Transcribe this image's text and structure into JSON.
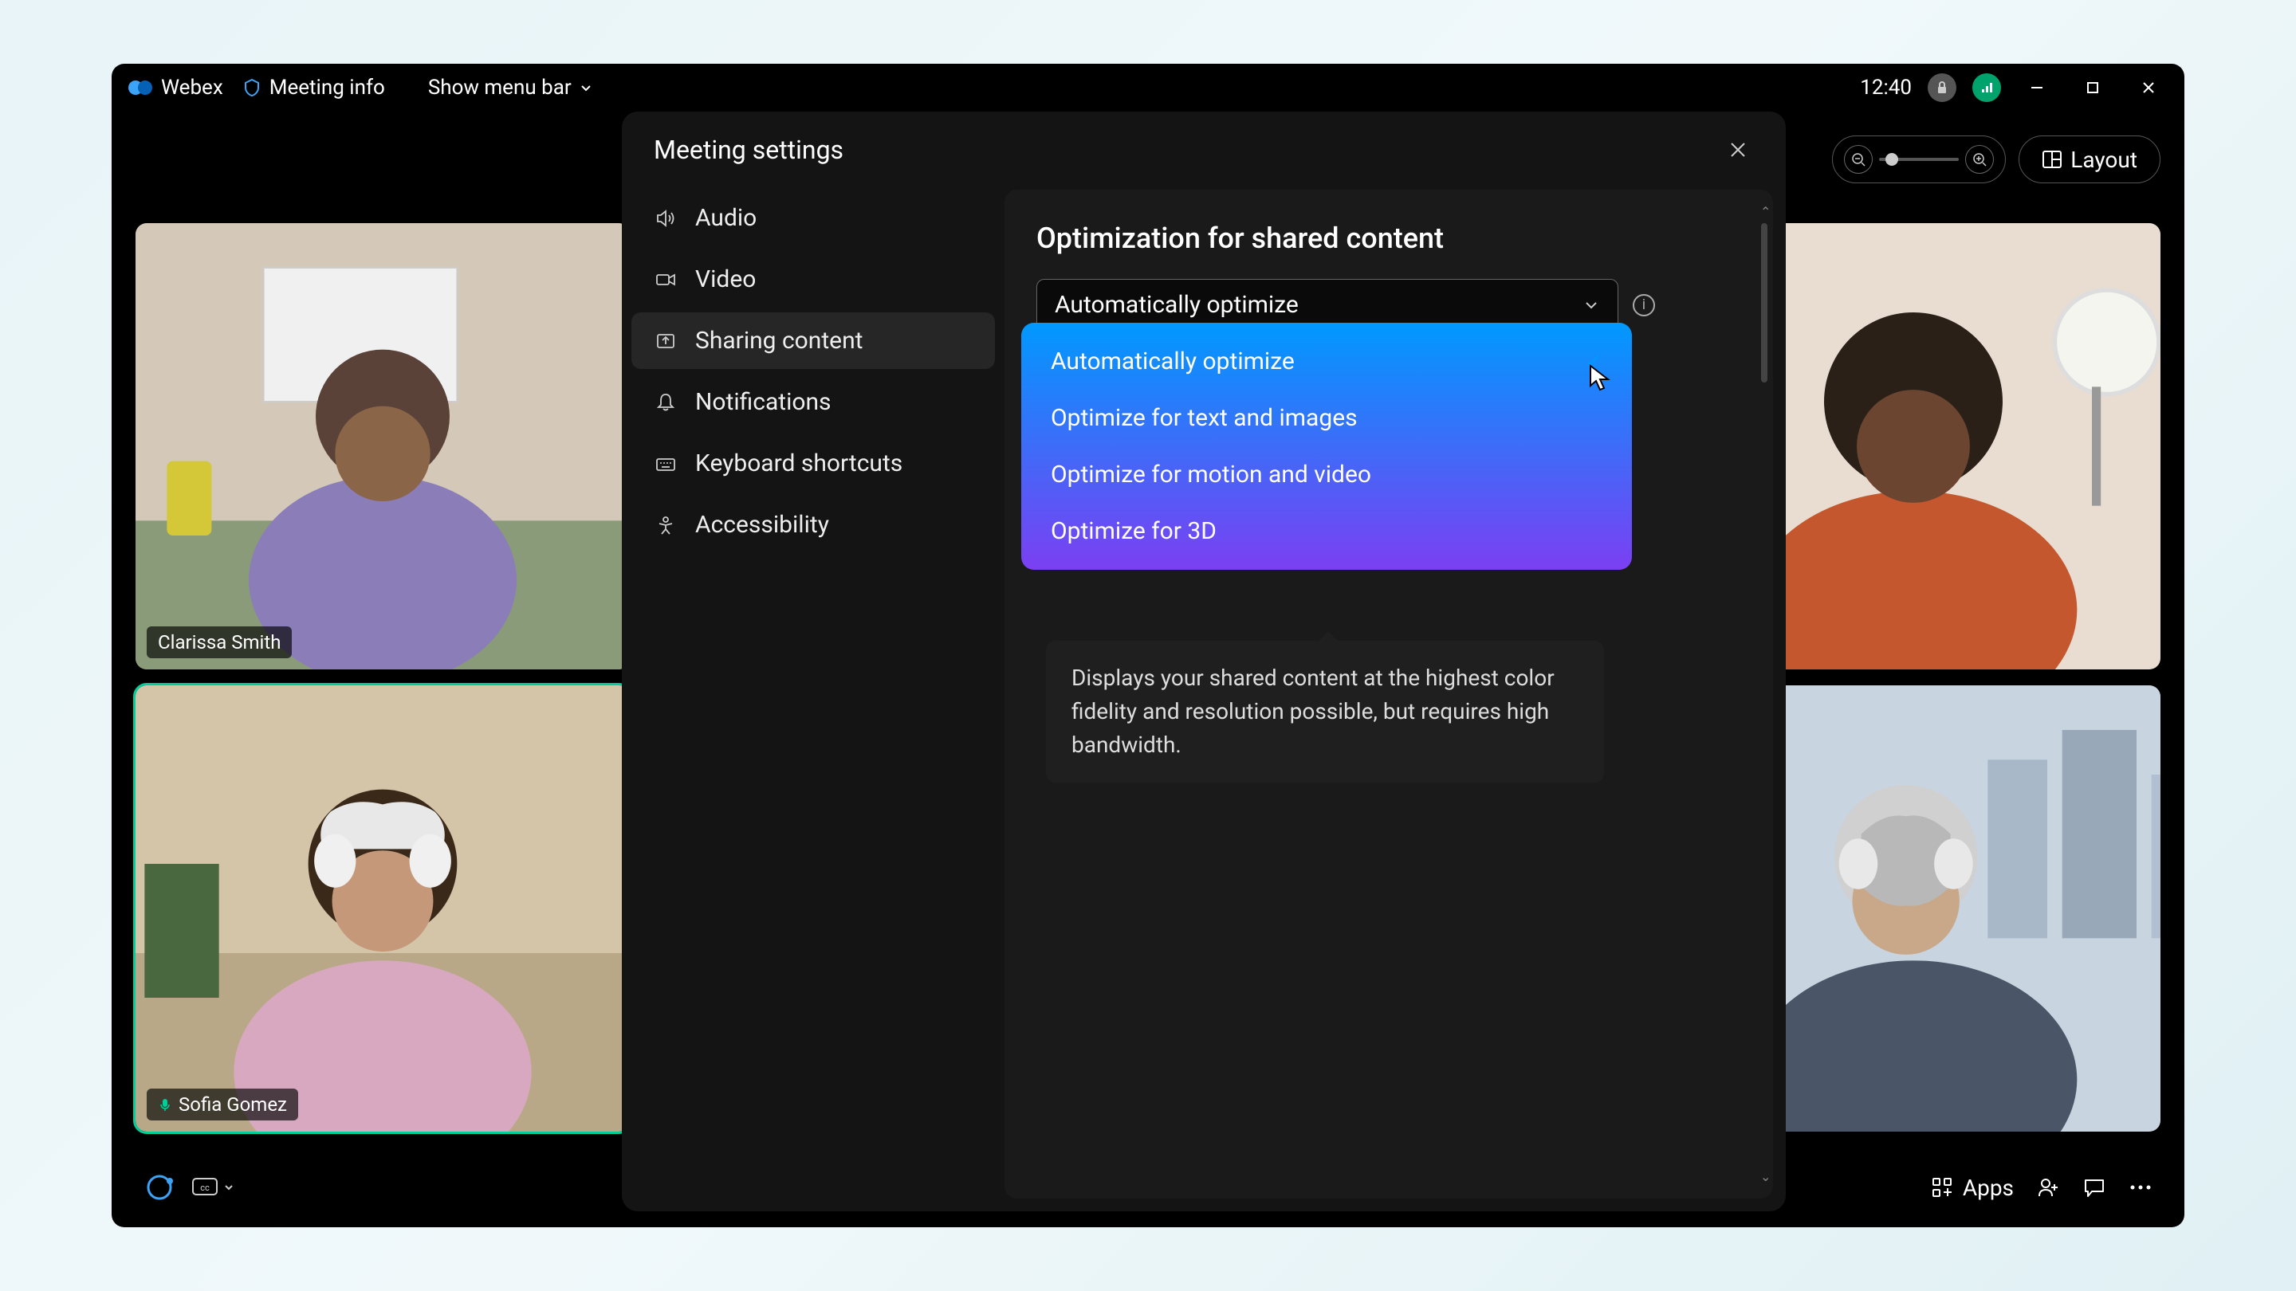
{
  "titlebar": {
    "app_name": "Webex",
    "meeting_info": "Meeting info",
    "menu_bar": "Show menu bar",
    "clock": "12:40"
  },
  "toolbar": {
    "layout": "Layout"
  },
  "participants": [
    {
      "name": "Clarissa Smith",
      "speaking": false
    },
    {
      "name": "Sofia Gomez",
      "speaking": true
    }
  ],
  "bottom": {
    "apps": "Apps"
  },
  "dialog": {
    "title": "Meeting settings",
    "sidebar": [
      {
        "icon": "speaker",
        "label": "Audio"
      },
      {
        "icon": "video",
        "label": "Video"
      },
      {
        "icon": "share",
        "label": "Sharing content",
        "active": true
      },
      {
        "icon": "bell",
        "label": "Notifications"
      },
      {
        "icon": "keyboard",
        "label": "Keyboard shortcuts"
      },
      {
        "icon": "accessibility",
        "label": "Accessibility"
      }
    ],
    "content": {
      "heading": "Optimization for shared content",
      "selected": "Automatically optimize",
      "options": [
        "Automatically optimize",
        "Optimize for text and images",
        "Optimize for motion and video",
        "Optimize for 3D"
      ],
      "tooltip": "Displays your shared content at the highest color fidelity and resolution possible, but requires high bandwidth."
    }
  }
}
